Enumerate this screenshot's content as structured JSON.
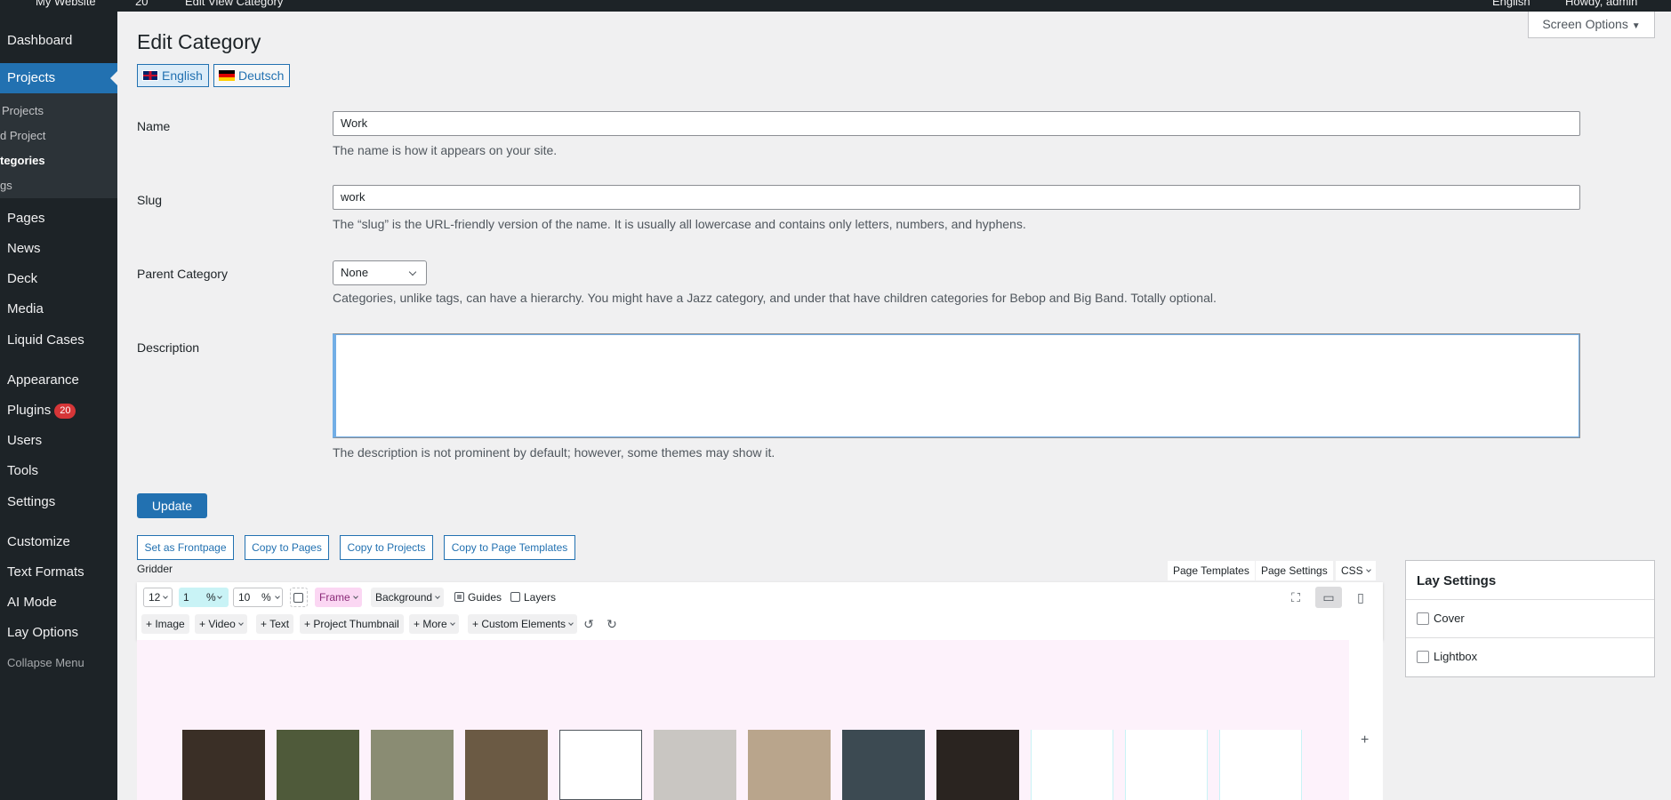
{
  "adminbar": {
    "site": "My Website",
    "updates": "20",
    "search": "Edit View Category",
    "language": "English",
    "howdy": "Howdy, admin"
  },
  "sidebar": {
    "dashboard": "Dashboard",
    "projects": "Projects",
    "sub": [
      "Projects",
      "d Project",
      "tegories",
      "gs"
    ],
    "pages": "Pages",
    "news": "News",
    "deck": "Deck",
    "media": "Media",
    "liquid_cases": "Liquid Cases",
    "appearance": "Appearance",
    "plugins": "Plugins",
    "plugins_badge": "20",
    "users": "Users",
    "tools": "Tools",
    "settings": "Settings",
    "customize": "Customize",
    "text_formats": "Text Formats",
    "ai_mode": "AI Mode",
    "lay_options": "Lay Options",
    "collapse": "Collapse Menu"
  },
  "screen_options": "Screen Options",
  "page": {
    "title": "Edit Category",
    "languages": [
      "English",
      "Deutsch"
    ]
  },
  "form": {
    "name_label": "Name",
    "name_value": "Work",
    "name_desc": "The name is how it appears on your site.",
    "slug_label": "Slug",
    "slug_value": "work",
    "slug_desc": "The “slug” is the URL-friendly version of the name. It is usually all lowercase and contains only letters, numbers, and hyphens.",
    "parent_label": "Parent Category",
    "parent_value": "None",
    "parent_desc": "Categories, unlike tags, can have a hierarchy. You might have a Jazz category, and under that have children categories for Bebop and Big Band. Totally optional.",
    "description_label": "Description",
    "description_desc": "The description is not prominent by default; however, some themes may show it.",
    "update": "Update"
  },
  "copy_buttons": [
    "Set as Frontpage",
    "Copy to Pages",
    "Copy to Projects",
    "Copy to Page Templates"
  ],
  "gridder": {
    "label": "Gridder",
    "tabs": [
      "Page Templates",
      "Page Settings",
      "CSS"
    ],
    "columns": "12",
    "gutter": "1",
    "gutter_unit": "%",
    "margin": "10",
    "margin_unit": "%",
    "frame": "Frame",
    "background": "Background",
    "guides": "Guides",
    "layers": "Layers",
    "add": [
      "+ Image",
      "+ Video",
      "+ Text",
      "+ Project Thumbnail",
      "+ More",
      "+ Custom Elements"
    ],
    "plus": "+"
  },
  "lay_settings": {
    "title": "Lay Settings",
    "cover": "Cover",
    "lightbox": "Lightbox"
  },
  "thumb_colors": [
    "#3a2f26",
    "#4f5a3a",
    "#8a8c73",
    "#6b5a44",
    "#ffffff",
    "#c9c6c2",
    "#b9a58c",
    "#3c4a52",
    "#2a2420"
  ]
}
